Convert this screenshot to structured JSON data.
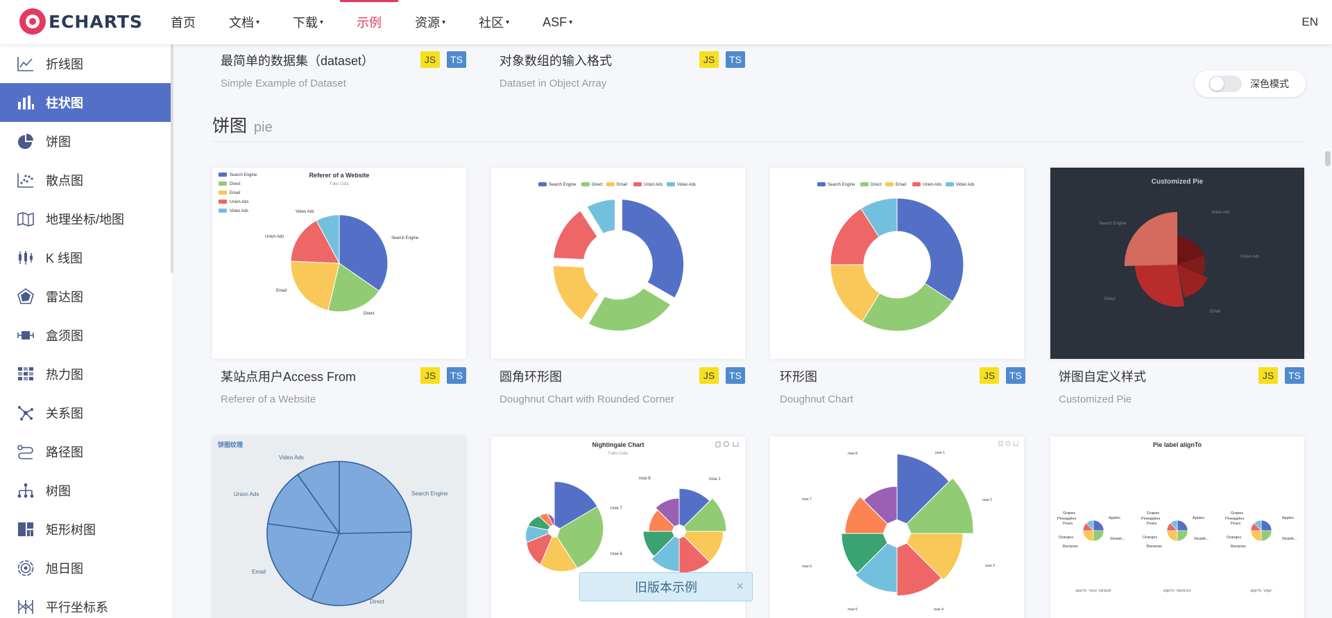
{
  "header": {
    "logo_text": "ECHARTS",
    "nav": [
      {
        "label": "首页",
        "dropdown": false,
        "active": false
      },
      {
        "label": "文档",
        "dropdown": true,
        "active": false
      },
      {
        "label": "下载",
        "dropdown": true,
        "active": false
      },
      {
        "label": "示例",
        "dropdown": false,
        "active": true
      },
      {
        "label": "资源",
        "dropdown": true,
        "active": false
      },
      {
        "label": "社区",
        "dropdown": true,
        "active": false
      },
      {
        "label": "ASF",
        "dropdown": true,
        "active": false
      }
    ],
    "caret": "▾",
    "lang": "EN"
  },
  "sidebar": {
    "items": [
      {
        "label": "折线图",
        "icon": "line-chart-icon"
      },
      {
        "label": "柱状图",
        "icon": "bar-chart-icon",
        "active": true
      },
      {
        "label": "饼图",
        "icon": "pie-chart-icon"
      },
      {
        "label": "散点图",
        "icon": "scatter-chart-icon"
      },
      {
        "label": "地理坐标/地图",
        "icon": "map-icon"
      },
      {
        "label": "K 线图",
        "icon": "candlestick-icon"
      },
      {
        "label": "雷达图",
        "icon": "radar-icon"
      },
      {
        "label": "盒须图",
        "icon": "boxplot-icon"
      },
      {
        "label": "热力图",
        "icon": "heatmap-icon"
      },
      {
        "label": "关系图",
        "icon": "graph-icon"
      },
      {
        "label": "路径图",
        "icon": "lines-icon"
      },
      {
        "label": "树图",
        "icon": "tree-icon"
      },
      {
        "label": "矩形树图",
        "icon": "treemap-icon"
      },
      {
        "label": "旭日图",
        "icon": "sunburst-icon"
      },
      {
        "label": "平行坐标系",
        "icon": "parallel-icon"
      }
    ]
  },
  "dark_mode": {
    "label": "深色模式",
    "enabled": false
  },
  "badges": {
    "js": "JS",
    "ts": "TS"
  },
  "top_row": [
    {
      "title": "最简单的数据集（dataset）",
      "subtitle": "Simple Example of Dataset"
    },
    {
      "title": "对象数组的输入格式",
      "subtitle": "Dataset in Object Array"
    }
  ],
  "section": {
    "title": "饼图",
    "subtitle": "pie"
  },
  "cards": [
    {
      "title": "某站点用户Access From",
      "subtitle": "Referer of a Website"
    },
    {
      "title": "圆角环形图",
      "subtitle": "Doughnut Chart with Rounded Corner"
    },
    {
      "title": "环形图",
      "subtitle": "Doughnut Chart"
    },
    {
      "title": "饼图自定义样式",
      "subtitle": "Customized Pie"
    }
  ],
  "thumbs": {
    "referer": {
      "title": "Referer of a Website",
      "subtitle": "Fake Data",
      "legend": [
        "Search Engine",
        "Direct",
        "Email",
        "Union Ads",
        "Video Ads"
      ]
    },
    "legend5": [
      "Search Engine",
      "Direct",
      "Email",
      "Union Ads",
      "Video Ads"
    ],
    "custom": {
      "title": "Customized Pie",
      "labels": [
        "Search Engine",
        "Video Ads",
        "Union Ads",
        "Email",
        "Direct"
      ]
    },
    "texture": {
      "title": "饼图纹理",
      "labels": [
        "Video Ads",
        "Search Engine",
        "Union Ads",
        "Email",
        "Direct"
      ]
    },
    "nightingale": {
      "title": "Nightingale Chart",
      "subtitle": "Fake Data",
      "labels": [
        "rose 8",
        "rose 1",
        "rose 7",
        "rose 6"
      ]
    },
    "rose": {
      "labels": [
        "rose 8",
        "rose 1",
        "rose 7",
        "rose 2",
        "rose 6",
        "rose 3",
        "rose 5",
        "rose 4"
      ]
    },
    "align": {
      "title": "Pie label alignTo",
      "labels": [
        "Grapes",
        "Pineapples",
        "Pears",
        "Oranges",
        "Bananas",
        "Apples",
        "Strawb..."
      ],
      "captions": [
        "alignTo: 'none' (default)",
        "alignTo: 'labelLine'",
        "alignTo: 'edge'"
      ]
    }
  },
  "colors": {
    "blue": "#5470c6",
    "green": "#91cc75",
    "yellow": "#fac858",
    "red": "#ee6666",
    "cyan": "#73c0de",
    "teal": "#3ba272",
    "orange": "#fc8452",
    "purple": "#9a60b4",
    "accent": "#e43961"
  },
  "old_version": {
    "label": "旧版本示例",
    "close": "×"
  }
}
